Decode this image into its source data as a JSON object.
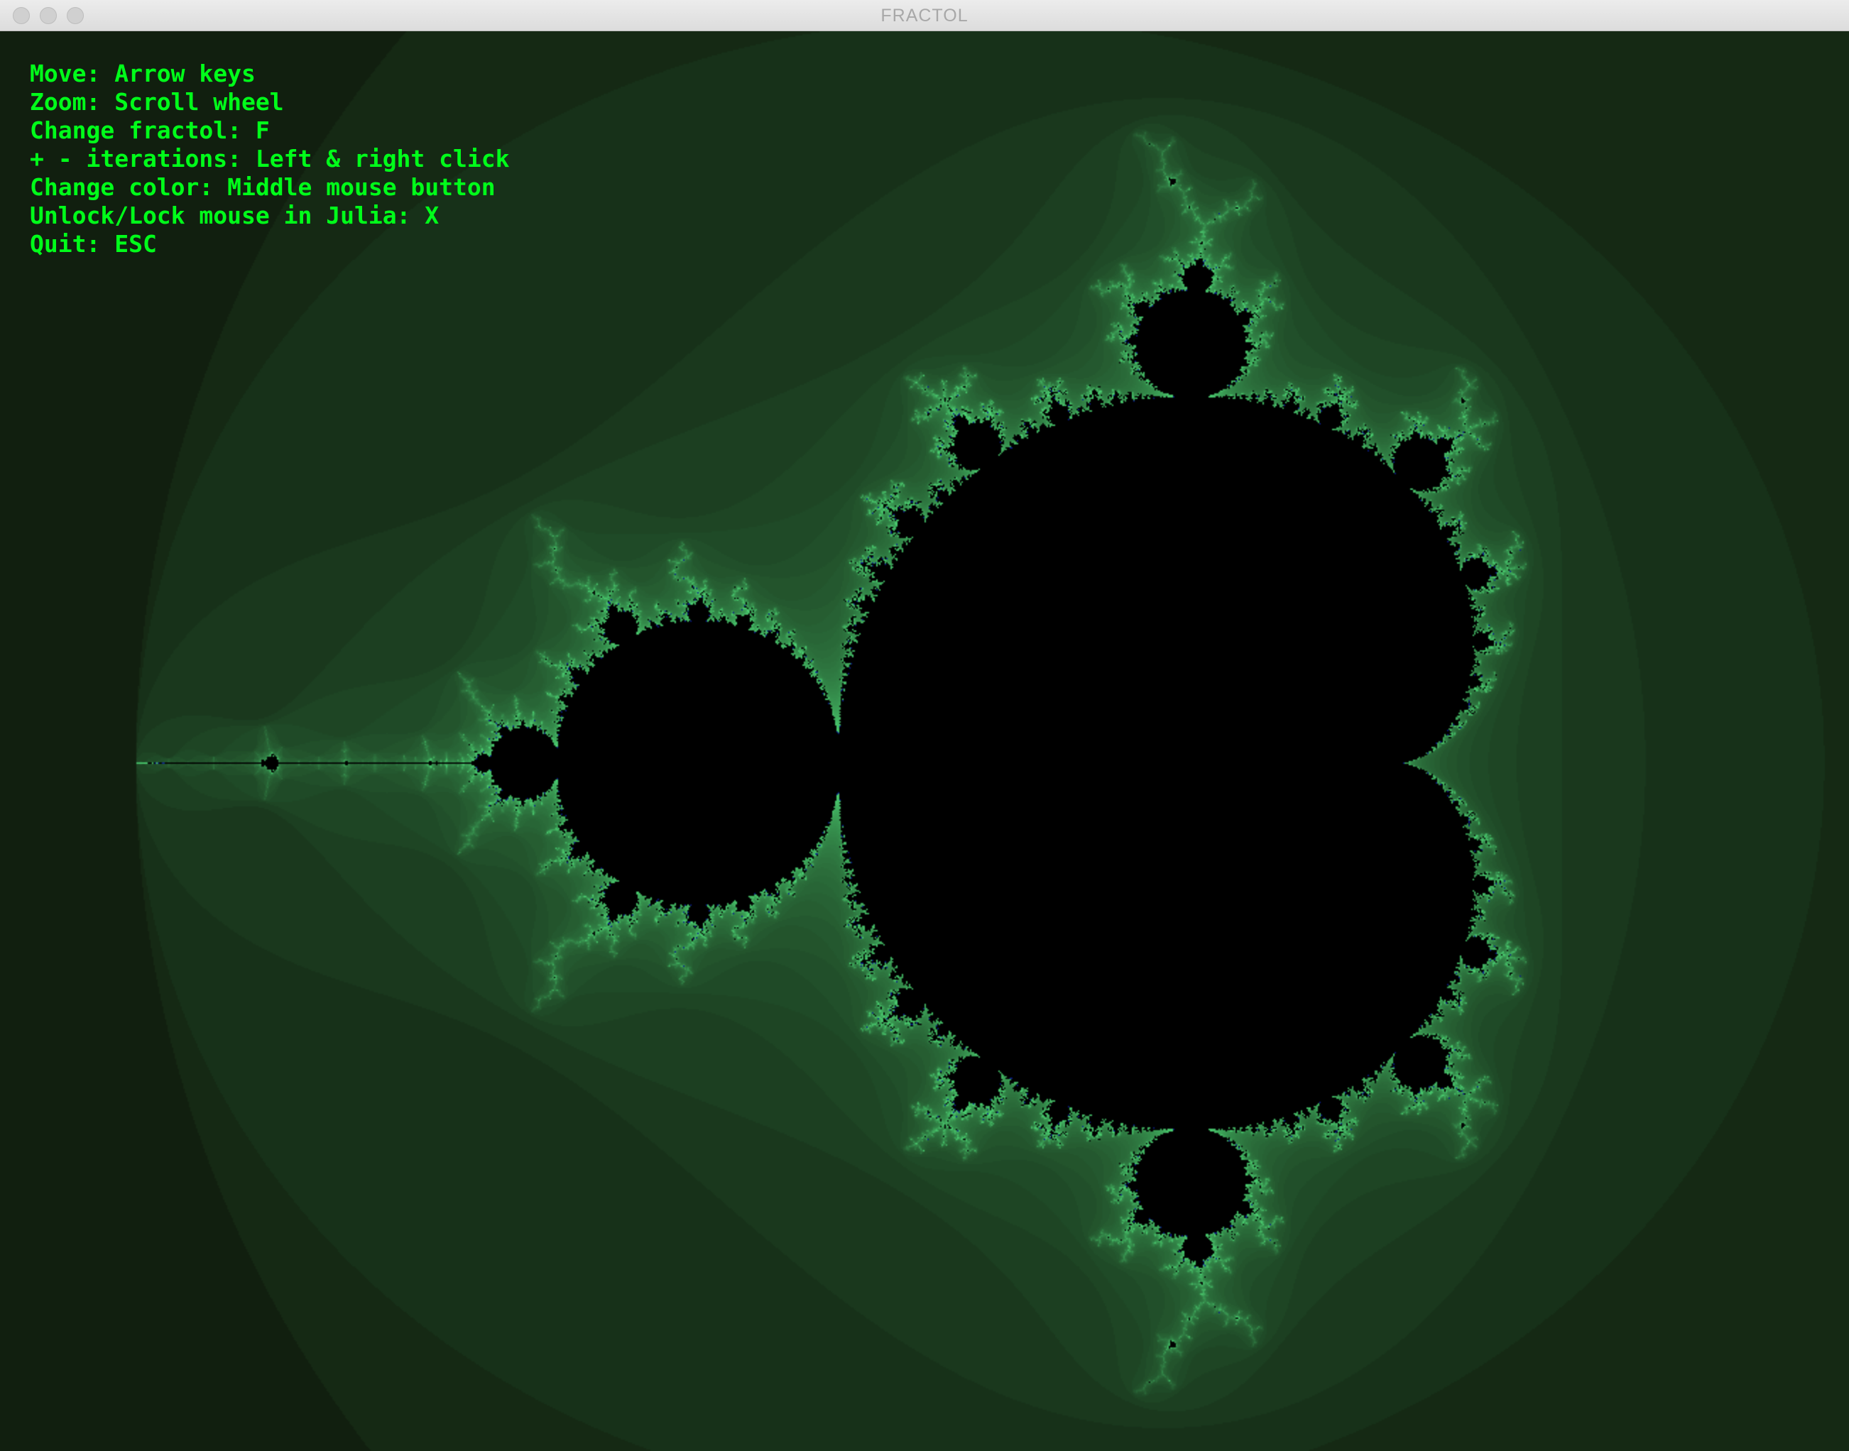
{
  "window": {
    "title": "FRACTOL"
  },
  "help": {
    "lines": [
      "Move: Arrow keys",
      "Zoom: Scroll wheel",
      "Change fractol: F",
      "+ - iterations: Left & right click",
      "Change color: Middle mouse button",
      "Unlock/Lock mouse in Julia: X",
      "Quit: ESC"
    ]
  },
  "fractal": {
    "type": "Mandelbrot",
    "palette": {
      "inside": "#000000",
      "edge": "#3fdc7c",
      "outer": "#001a05",
      "accent": "#0a1a8c"
    }
  }
}
